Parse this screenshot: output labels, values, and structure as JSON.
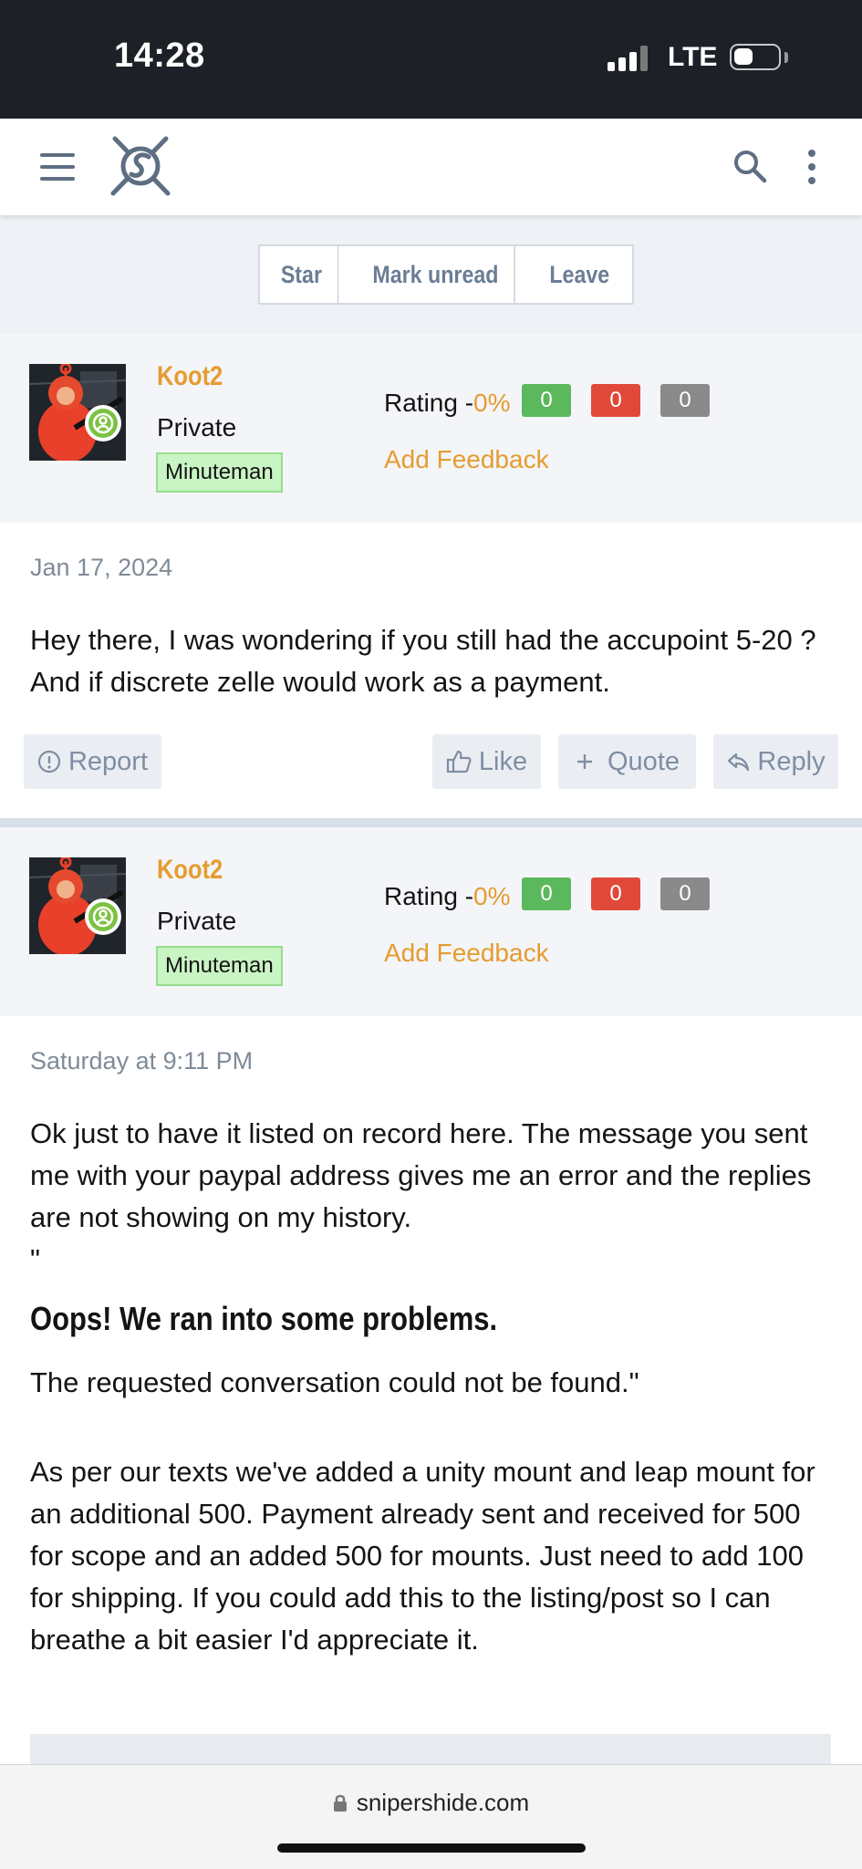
{
  "status_bar": {
    "time": "14:28",
    "network": "LTE"
  },
  "header": {
    "menu_icon": "hamburger-icon",
    "logo_icon": "sniper-logo-icon",
    "search_icon": "search-icon",
    "more_icon": "more-vertical-icon"
  },
  "conversation_actions": [
    {
      "label": "Star"
    },
    {
      "label": "Mark unread"
    },
    {
      "label": "Leave"
    }
  ],
  "messages": [
    {
      "author": {
        "username": "Koot2",
        "title": "Private",
        "badge": "Minuteman"
      },
      "rating": {
        "label": "Rating -",
        "percent": "0%",
        "positive": "0",
        "negative": "0",
        "neutral": "0",
        "add_feedback": "Add Feedback"
      },
      "date": "Jan 17, 2024",
      "body": "Hey there, I was wondering if you still had the accupoint 5-20 ? And if discrete zelle would work as a payment.",
      "actions": {
        "report": "Report",
        "like": "Like",
        "quote": "Quote",
        "reply": "Reply"
      }
    },
    {
      "author": {
        "username": "Koot2",
        "title": "Private",
        "badge": "Minuteman"
      },
      "rating": {
        "label": "Rating -",
        "percent": "0%",
        "positive": "0",
        "negative": "0",
        "neutral": "0",
        "add_feedback": "Add Feedback"
      },
      "date": "Saturday at 9:11 PM",
      "body_intro": "Ok just to have it listed on record here. The message you sent me with your paypal address gives me an error and the replies are not showing on my history.",
      "body_quote_mark": "\"",
      "error_heading": "Oops! We ran into some problems.",
      "error_text": "The requested conversation could not be found.\"",
      "body_rest": "As per our texts we've added a unity mount and leap mount for an additional 500. Payment already sent and received for 500 for scope and an added 500 for mounts. Just need to add 100 for shipping. If you could add this to the listing/post so I can breathe a bit easier I'd appreciate it."
    }
  ],
  "colors": {
    "positive": "#5cb85c",
    "negative": "#e0493a",
    "neutral": "#8a8a8a",
    "accent": "#e59c2f"
  },
  "browser": {
    "url": "snipershide.com"
  }
}
